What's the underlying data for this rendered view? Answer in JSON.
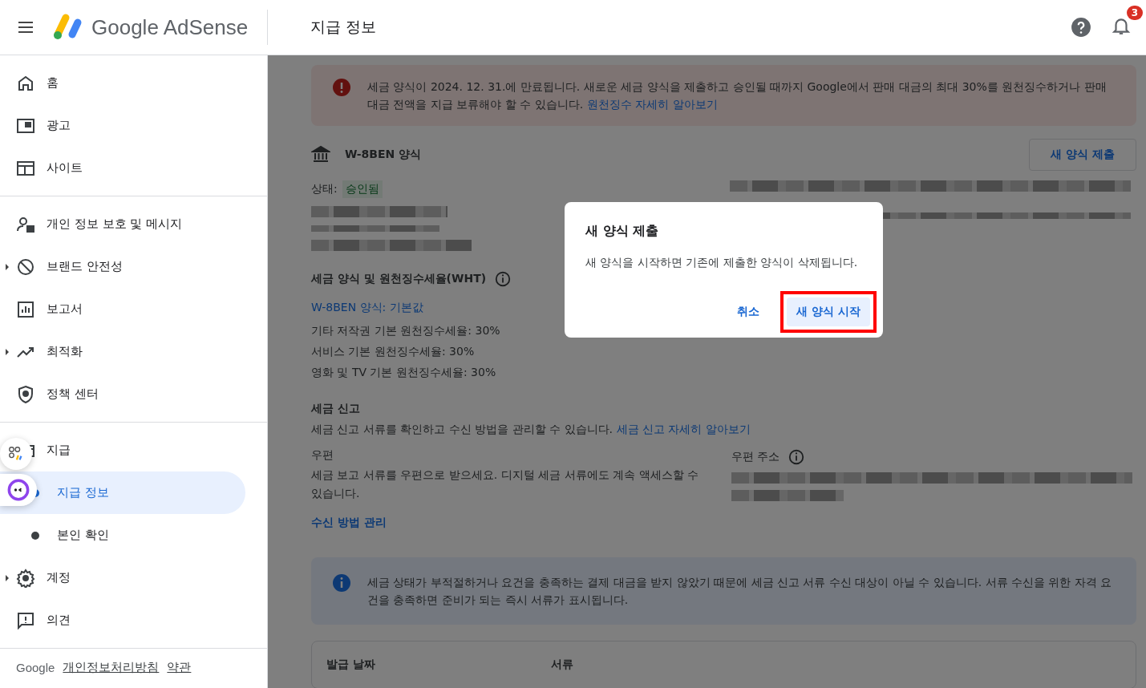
{
  "header": {
    "logo_text": "Google AdSense",
    "page_title": "지급 정보",
    "notification_count": "3"
  },
  "sidebar": {
    "groups": [
      [
        {
          "label": "홈",
          "expandable": false,
          "selected": false
        },
        {
          "label": "광고",
          "expandable": false,
          "selected": false
        },
        {
          "label": "사이트",
          "expandable": false,
          "selected": false
        }
      ],
      [
        {
          "label": "개인 정보 보호 및 메시지",
          "expandable": false,
          "selected": false
        },
        {
          "label": "브랜드 안전성",
          "expandable": true,
          "selected": false
        },
        {
          "label": "보고서",
          "expandable": false,
          "selected": false
        },
        {
          "label": "최적화",
          "expandable": true,
          "selected": false
        },
        {
          "label": "정책 센터",
          "expandable": false,
          "selected": false
        }
      ],
      [
        {
          "label": "지급",
          "expandable": false,
          "selected": false,
          "children": [
            {
              "label": "지급 정보",
              "selected": true
            },
            {
              "label": "본인 확인",
              "selected": false
            }
          ]
        },
        {
          "label": "계정",
          "expandable": true,
          "selected": false
        },
        {
          "label": "의견",
          "expandable": false,
          "selected": false
        }
      ]
    ],
    "footer": {
      "brand": "Google",
      "links": [
        "개인정보처리방침",
        "약관"
      ]
    }
  },
  "alert": {
    "text": "세금 양식이 2024. 12. 31.에 만료됩니다. 새로운 세금 양식을 제출하고 승인될 때까지 Google에서 판매 대금의 최대 30%를 원천징수하거나 판매 대금 전액을 지급 보류해야 할 수 있습니다.",
    "link": "원천징수 자세히 알아보기"
  },
  "form": {
    "title": "W-8BEN 양식",
    "button": "새 양식 제출",
    "status_label": "상태:",
    "status_value": "승인됨"
  },
  "wht": {
    "title": "세금 양식 및 원천징수세율(WHT)",
    "link": "W-8BEN 양식: 기본값",
    "rates": [
      "기타 저작권 기본 원천징수세율: 30%",
      "서비스 기본 원천징수세율: 30%",
      "영화 및 TV 기본 원천징수세율: 30%"
    ]
  },
  "tax_docs": {
    "title": "세금 신고",
    "text": "세금 신고 서류를 확인하고 수신 방법을 관리할 수 있습니다.",
    "link": "세금 신고 자세히 알아보기",
    "mail_label": "우편",
    "mail_text": "세금 보고 서류를 우편으로 받으세요. 디지털 세금 서류에도 계속 액세스할 수 있습니다.",
    "address_label": "우편 주소",
    "manage_link": "수신 방법 관리"
  },
  "info": {
    "text": "세금 상태가 부적절하거나 요건을 충족하는 결제 대금을 받지 않았기 때문에 세금 신고 서류 수신 대상이 아닐 수 있습니다. 서류 수신을 위한 자격 요건을 충족하면 준비가 되는 즉시 서류가 표시됩니다."
  },
  "table": {
    "columns": [
      "발급 날짜",
      "서류"
    ]
  },
  "dialog": {
    "title": "새 양식 제출",
    "text": "새 양식을 시작하면 기존에 제출한 양식이 삭제됩니다.",
    "buttons": [
      {
        "label": "취소",
        "kind": "text",
        "highlighted": false
      },
      {
        "label": "새 양식 시작",
        "kind": "tonal",
        "highlighted": true
      }
    ]
  }
}
